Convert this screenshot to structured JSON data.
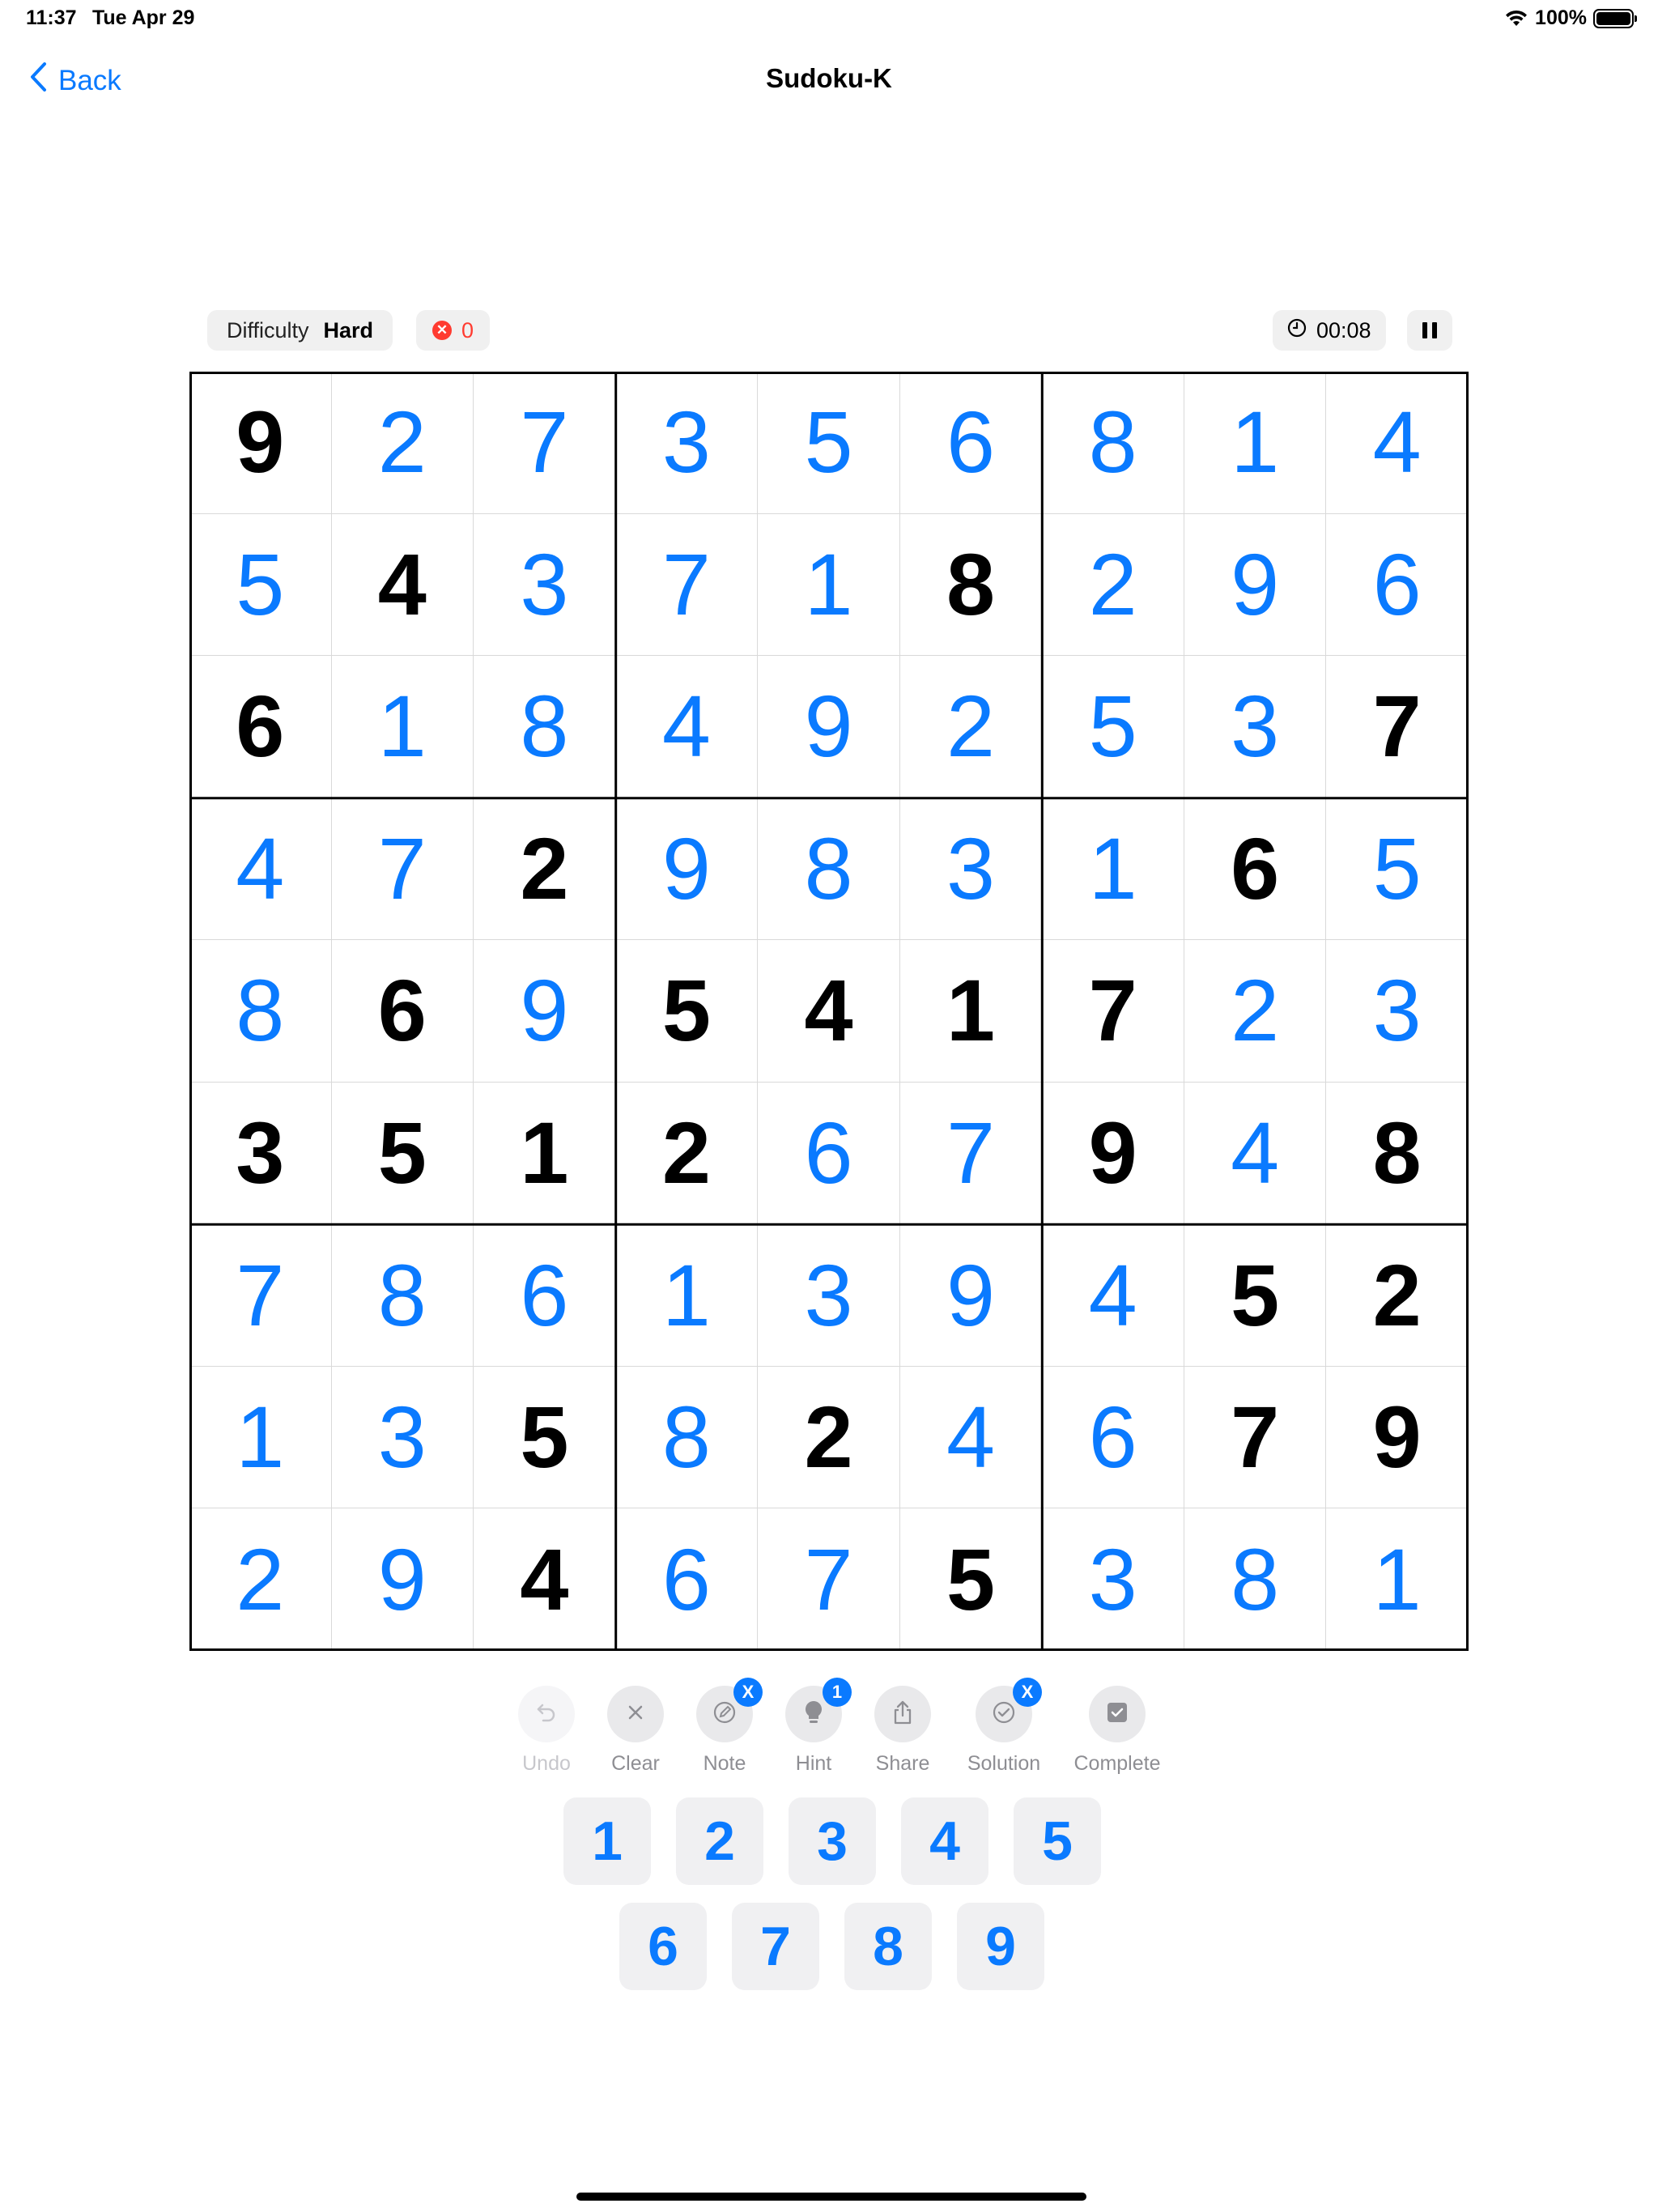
{
  "status": {
    "time": "11:37",
    "date": "Tue Apr 29",
    "battery": "100%",
    "battery_level": 1.0
  },
  "nav": {
    "back_label": "Back",
    "title": "Sudoku-K"
  },
  "info": {
    "difficulty_label": "Difficulty",
    "difficulty_value": "Hard",
    "mistakes": "0",
    "timer": "00:08"
  },
  "board": {
    "values": [
      [
        "9",
        "2",
        "7",
        "3",
        "5",
        "6",
        "8",
        "1",
        "4"
      ],
      [
        "5",
        "4",
        "3",
        "7",
        "1",
        "8",
        "2",
        "9",
        "6"
      ],
      [
        "6",
        "1",
        "8",
        "4",
        "9",
        "2",
        "5",
        "3",
        "7"
      ],
      [
        "4",
        "7",
        "2",
        "9",
        "8",
        "3",
        "1",
        "6",
        "5"
      ],
      [
        "8",
        "6",
        "9",
        "5",
        "4",
        "1",
        "7",
        "2",
        "3"
      ],
      [
        "3",
        "5",
        "1",
        "2",
        "6",
        "7",
        "9",
        "4",
        "8"
      ],
      [
        "7",
        "8",
        "6",
        "1",
        "3",
        "9",
        "4",
        "5",
        "2"
      ],
      [
        "1",
        "3",
        "5",
        "8",
        "2",
        "4",
        "6",
        "7",
        "9"
      ],
      [
        "2",
        "9",
        "4",
        "6",
        "7",
        "5",
        "3",
        "8",
        "1"
      ]
    ],
    "givens": [
      [
        1,
        0,
        0,
        0,
        0,
        0,
        0,
        0,
        0
      ],
      [
        0,
        1,
        0,
        0,
        0,
        1,
        0,
        0,
        0
      ],
      [
        1,
        0,
        0,
        0,
        0,
        0,
        0,
        0,
        1
      ],
      [
        0,
        0,
        1,
        0,
        0,
        0,
        0,
        1,
        0
      ],
      [
        0,
        1,
        0,
        1,
        1,
        1,
        1,
        0,
        0
      ],
      [
        1,
        1,
        1,
        1,
        0,
        0,
        1,
        0,
        1
      ],
      [
        0,
        0,
        0,
        0,
        0,
        0,
        0,
        1,
        1
      ],
      [
        0,
        0,
        1,
        0,
        1,
        0,
        0,
        1,
        1
      ],
      [
        0,
        0,
        1,
        0,
        0,
        1,
        0,
        0,
        0
      ]
    ],
    "given_color": "#000000",
    "entry_color": "#0a7aff"
  },
  "actions": [
    {
      "id": "undo",
      "label": "Undo",
      "icon": "undo-icon",
      "disabled": true,
      "badge": ""
    },
    {
      "id": "clear",
      "label": "Clear",
      "icon": "clear-icon",
      "disabled": false,
      "badge": ""
    },
    {
      "id": "note",
      "label": "Note",
      "icon": "pencil-icon",
      "disabled": false,
      "badge": "X"
    },
    {
      "id": "hint",
      "label": "Hint",
      "icon": "lightbulb-icon",
      "disabled": false,
      "badge": "1"
    },
    {
      "id": "share",
      "label": "Share",
      "icon": "share-icon",
      "disabled": false,
      "badge": ""
    },
    {
      "id": "solution",
      "label": "Solution",
      "icon": "checkmark-circle-icon",
      "disabled": false,
      "badge": "X"
    },
    {
      "id": "complete",
      "label": "Complete",
      "icon": "checkbox-icon",
      "disabled": false,
      "badge": ""
    }
  ],
  "keypad": [
    "1",
    "2",
    "3",
    "4",
    "5",
    "6",
    "7",
    "8",
    "9"
  ],
  "colors": {
    "accent": "#0a7aff",
    "error": "#ff3b30"
  }
}
